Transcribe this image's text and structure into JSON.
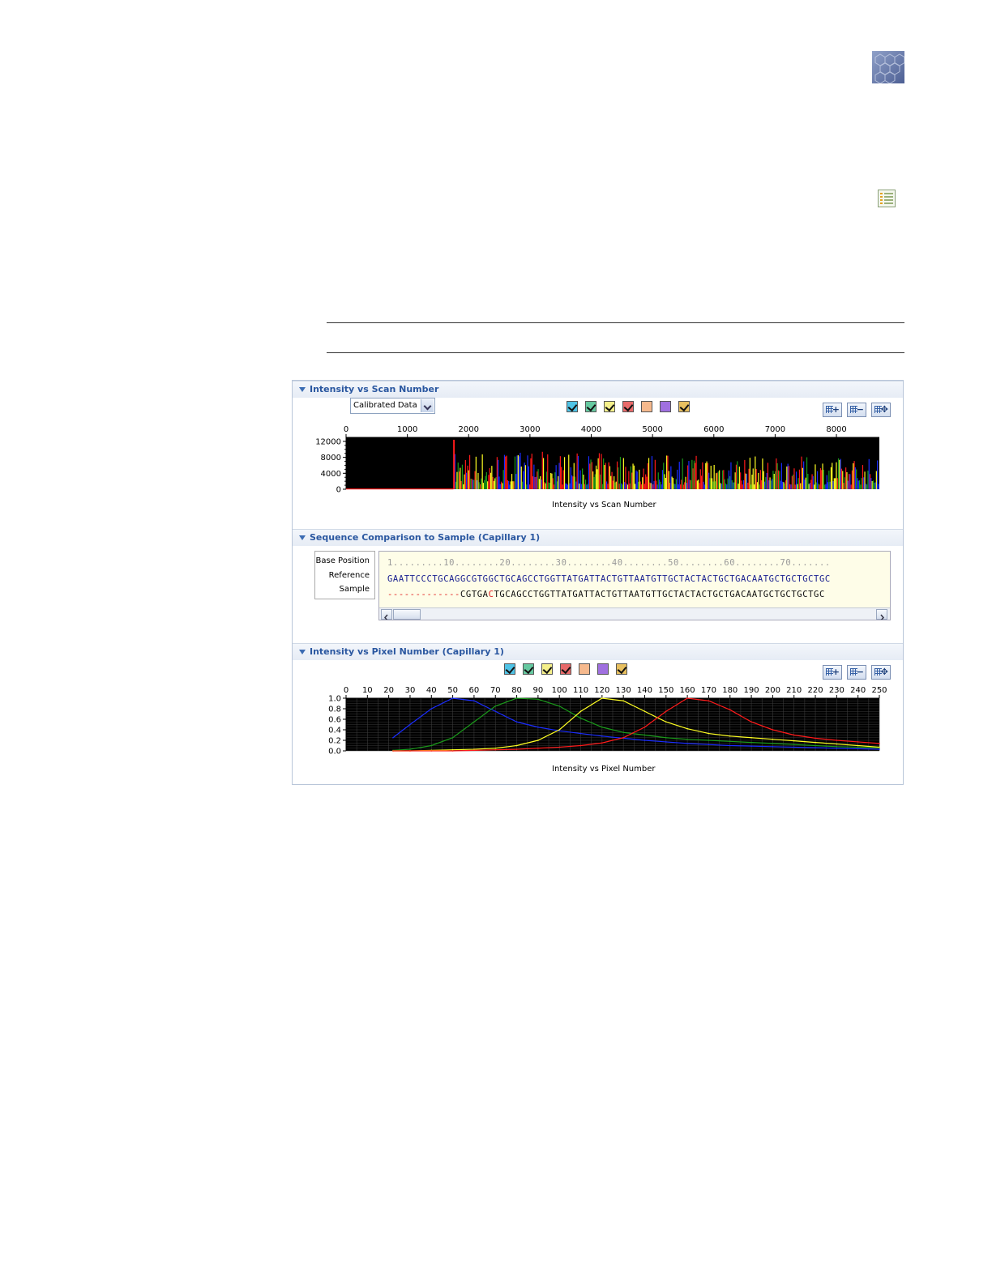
{
  "header": {
    "logo_icon": "hexagon-pattern-icon",
    "notes_icon": "notes-list-icon"
  },
  "sections": {
    "scan": {
      "title": "Intensity vs Scan Number",
      "dropdown_value": "Calibrated Data",
      "plot_title": "Intensity vs Scan Number"
    },
    "seq": {
      "title": "Sequence Comparison to Sample (Capillary 1)",
      "labels": [
        "Base Position",
        "Reference",
        "Sample"
      ],
      "ruler": "1.........10........20........30........40........50........60........70.......",
      "reference": "GAATTCCCTGCAGGCGTGGCTGCAGCCTGGTTATGATTACTGTTAATGTTGCTACTACTGCTGACAATGCTGCTGCTGC",
      "sample_dashes": "-------------",
      "sample_pre": "CGTGA",
      "sample_mismatch": "C",
      "sample_post": "TGCAGCCTGGTTATGATTACTGTTAATGTTGCTACTACTGCTGACAATGCTGCTGCTGC"
    },
    "pixel": {
      "title": "Intensity vs Pixel Number (Capillary 1)",
      "plot_title": "Intensity vs Pixel Number"
    }
  },
  "dye_colors": [
    "#4fc3e6",
    "#66c9a0",
    "#f5f08a",
    "#e86a6a",
    "#f6b98d",
    "#a070e0",
    "#e8c060"
  ],
  "zoom_buttons": [
    "zoom-in",
    "zoom-out",
    "fit"
  ],
  "colors": {
    "blue": "#1a2cff",
    "green": "#1a9a1a",
    "yellow": "#ffff22",
    "red": "#ff1a1a",
    "mismatch": "#e02020"
  },
  "chart_data": [
    {
      "type": "area",
      "title": "Intensity vs Scan Number",
      "xlim": [
        0,
        8700
      ],
      "ylim": [
        0,
        13000
      ],
      "x_ticks": [
        0,
        1000,
        2000,
        3000,
        4000,
        5000,
        6000,
        7000,
        8000
      ],
      "y_ticks": [
        0,
        4000,
        8000,
        12000
      ],
      "series_colors": [
        "blue",
        "green",
        "yellow",
        "red"
      ],
      "signal_start": 1750,
      "notable_peak": {
        "x": 1760,
        "y": 12400
      },
      "background": "black"
    },
    {
      "type": "line",
      "title": "Intensity vs Pixel Number",
      "xlim": [
        0,
        250
      ],
      "ylim": [
        0,
        1.0
      ],
      "x_ticks": [
        0,
        10,
        20,
        30,
        40,
        50,
        60,
        70,
        80,
        90,
        100,
        110,
        120,
        130,
        140,
        150,
        160,
        170,
        180,
        190,
        200,
        210,
        220,
        230,
        240,
        250
      ],
      "y_ticks": [
        0.0,
        0.2,
        0.4,
        0.6,
        0.8,
        1.0
      ],
      "grid": true,
      "background": "black",
      "x": [
        22,
        30,
        40,
        50,
        60,
        70,
        80,
        90,
        100,
        110,
        120,
        130,
        140,
        150,
        160,
        170,
        180,
        190,
        200,
        210,
        220,
        230,
        240,
        250
      ],
      "series": [
        {
          "color": "blue",
          "values": [
            0.25,
            0.5,
            0.8,
            1.0,
            0.95,
            0.75,
            0.55,
            0.45,
            0.38,
            0.33,
            0.28,
            0.24,
            0.2,
            0.17,
            0.14,
            0.12,
            0.1,
            0.09,
            0.08,
            0.07,
            0.06,
            0.05,
            0.04,
            0.03
          ]
        },
        {
          "color": "green",
          "values": [
            0.01,
            0.03,
            0.1,
            0.25,
            0.55,
            0.85,
            1.0,
            0.98,
            0.85,
            0.62,
            0.45,
            0.35,
            0.3,
            0.25,
            0.22,
            0.2,
            0.18,
            0.16,
            0.14,
            0.12,
            0.1,
            0.08,
            0.07,
            0.06
          ]
        },
        {
          "color": "yellow",
          "values": [
            0.0,
            0.0,
            0.01,
            0.02,
            0.03,
            0.05,
            0.1,
            0.2,
            0.4,
            0.75,
            1.0,
            0.95,
            0.75,
            0.55,
            0.42,
            0.33,
            0.28,
            0.25,
            0.22,
            0.19,
            0.16,
            0.13,
            0.1,
            0.07
          ]
        },
        {
          "color": "red",
          "values": [
            0.0,
            0.0,
            0.0,
            0.0,
            0.01,
            0.02,
            0.03,
            0.05,
            0.07,
            0.1,
            0.15,
            0.25,
            0.45,
            0.75,
            1.0,
            0.95,
            0.78,
            0.55,
            0.4,
            0.3,
            0.24,
            0.2,
            0.17,
            0.14
          ]
        }
      ]
    }
  ]
}
